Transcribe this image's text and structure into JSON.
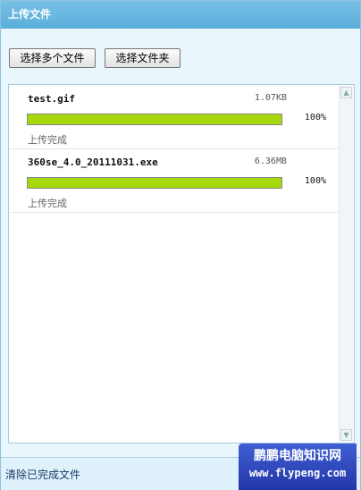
{
  "window": {
    "title": "上传文件"
  },
  "buttons": {
    "select_multiple": "选择多个文件",
    "select_folder": "选择文件夹"
  },
  "files": [
    {
      "name": "test.gif",
      "size": "1.07KB",
      "progress": 100,
      "percent_label": "100%",
      "status": "上传完成"
    },
    {
      "name": "360se_4.0_20111031.exe",
      "size": "6.36MB",
      "progress": 100,
      "percent_label": "100%",
      "status": "上传完成"
    }
  ],
  "footer": {
    "clear_label": "清除已完成文件"
  },
  "watermark": {
    "line1": "鹏鹏电脑知识网",
    "line2": "www.flypeng.com"
  },
  "colors": {
    "title_bg": "#5aaedb",
    "progress_fill": "#a7d80c",
    "panel_bg": "#e9f7fd",
    "watermark_bg": "#2f46c0"
  },
  "icons": [
    "scroll-up-arrow-icon",
    "scroll-down-arrow-icon"
  ]
}
